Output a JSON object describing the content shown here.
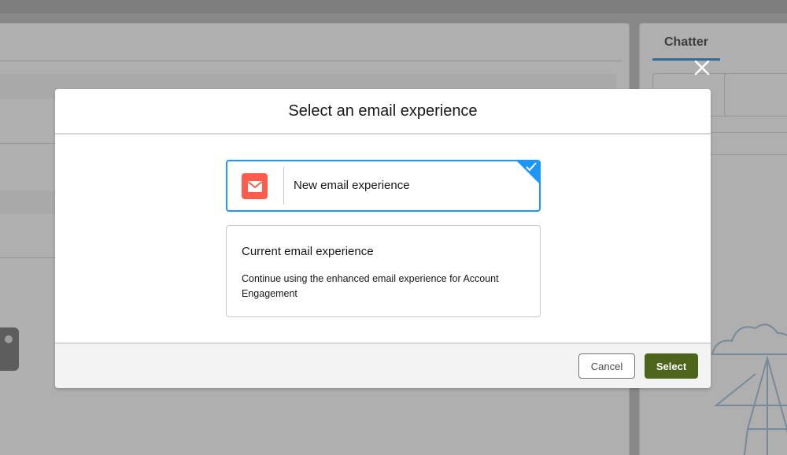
{
  "background": {
    "right_panel": {
      "tab_label": "Chatter"
    }
  },
  "modal": {
    "title": "Select an email experience",
    "options": [
      {
        "label": "New email experience",
        "selected": true,
        "icon": "email-icon",
        "icon_color": "#fe5c4c"
      },
      {
        "label": "Current email experience",
        "description": "Continue using the enhanced email experience for Account Engagement",
        "selected": false
      }
    ],
    "footer": {
      "cancel_label": "Cancel",
      "select_label": "Select"
    }
  },
  "colors": {
    "brand_blue": "#1b96ff",
    "select_button": "#4d651b",
    "email_tile": "#fe5c4c"
  }
}
